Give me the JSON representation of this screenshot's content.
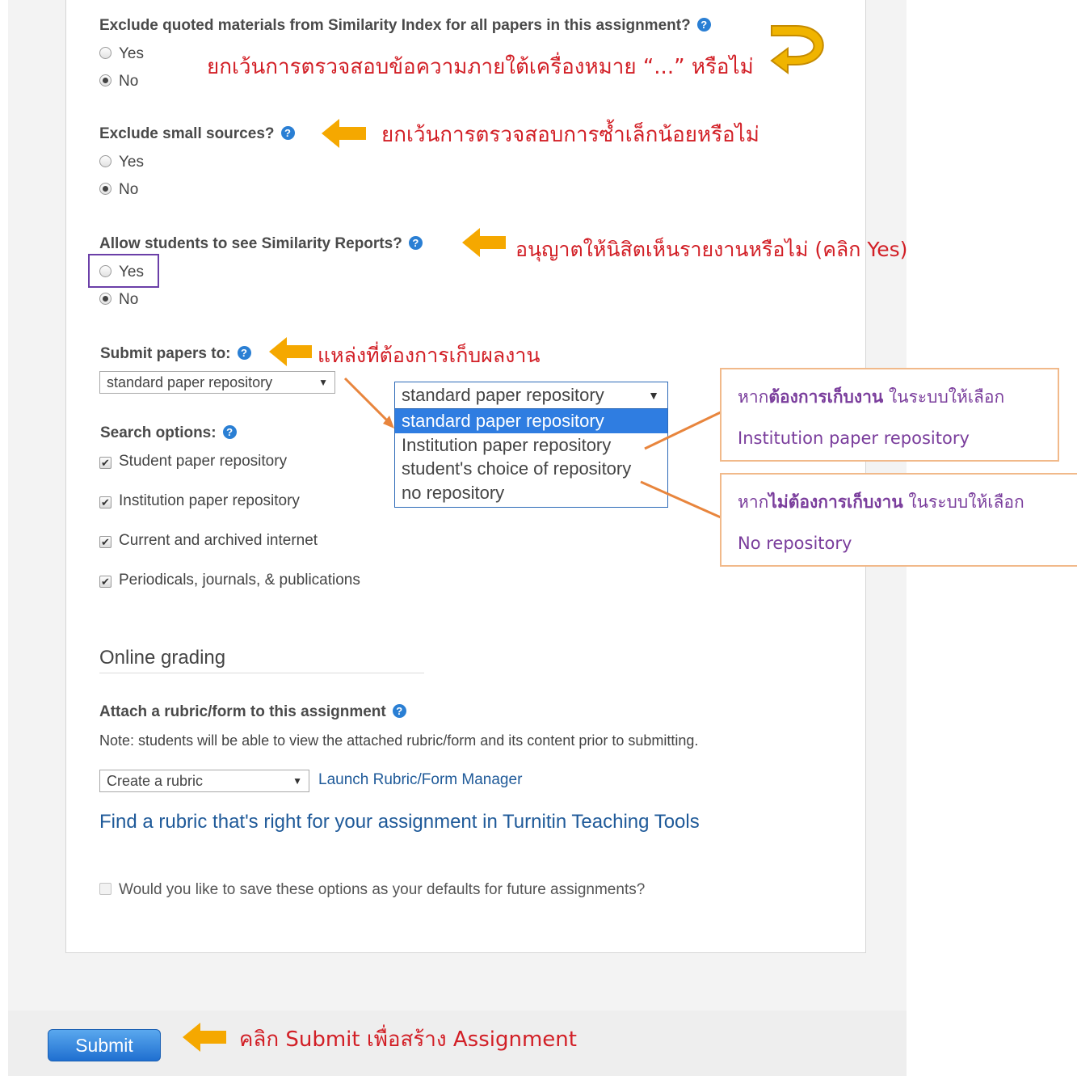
{
  "questions": {
    "exclude_quoted": {
      "label": "Exclude quoted materials from Similarity Index for all papers in this assignment?",
      "yes": "Yes",
      "no": "No",
      "selected": "No"
    },
    "exclude_small": {
      "label": "Exclude small sources?",
      "yes": "Yes",
      "no": "No",
      "selected": "No"
    },
    "allow_reports": {
      "label": "Allow students to see Similarity Reports?",
      "yes": "Yes",
      "no": "No",
      "selected": "No"
    }
  },
  "submit_papers": {
    "label": "Submit papers to:",
    "value": "standard paper repository"
  },
  "dropdown": {
    "header": "standard paper repository",
    "options": [
      "standard paper repository",
      "Institution paper repository",
      "student's choice of repository",
      "no repository"
    ],
    "selected_index": 0
  },
  "search_options": {
    "label": "Search options:",
    "items": [
      "Student paper repository",
      "Institution paper repository",
      "Current and archived internet",
      "Periodicals, journals, & publications"
    ]
  },
  "online_grading": {
    "section_title": "Online grading",
    "rubric_label": "Attach a rubric/form to this assignment",
    "note": "Note: students will be able to view the attached rubric/form and its content prior to submitting.",
    "rubric_select": "Create a rubric",
    "launch_link": "Launch Rubric/Form Manager",
    "find_link": "Find a rubric that's right for your assignment in Turnitin Teaching Tools"
  },
  "save_defaults": "Would you like to save these options as your defaults for future assignments?",
  "submit_button": "Submit",
  "annotations": {
    "quoted": "ยกเว้นการตรวจสอบข้อความภายใต้เครื่องหมาย “...” หรือไม่",
    "small": "ยกเว้นการตรวจสอบการซ้ำเล็กน้อยหรือไม่",
    "reports": "อนุญาตให้นิสิตเห็นรายงานหรือไม่ (คลิก Yes)",
    "repository": "แหล่งที่ต้องการเก็บผลงาน",
    "submit": "คลิก Submit เพื่อสร้าง Assignment"
  },
  "callouts": {
    "store": {
      "prefix": "หาก",
      "bold": "ต้องการเก็บงาน",
      "suffix": " ในระบบให้เลือก",
      "choice": "Institution paper repository"
    },
    "nostore": {
      "prefix": "หาก",
      "bold": "ไม่ต้องการเก็บงาน",
      "suffix": " ในระบบให้เลือก",
      "choice": "No repository"
    }
  },
  "colors": {
    "annotation_red": "#d21f26",
    "arrow_yellow": "#f5a800",
    "callout_purple": "#7a3d9c",
    "help_blue": "#2a7fd4"
  }
}
